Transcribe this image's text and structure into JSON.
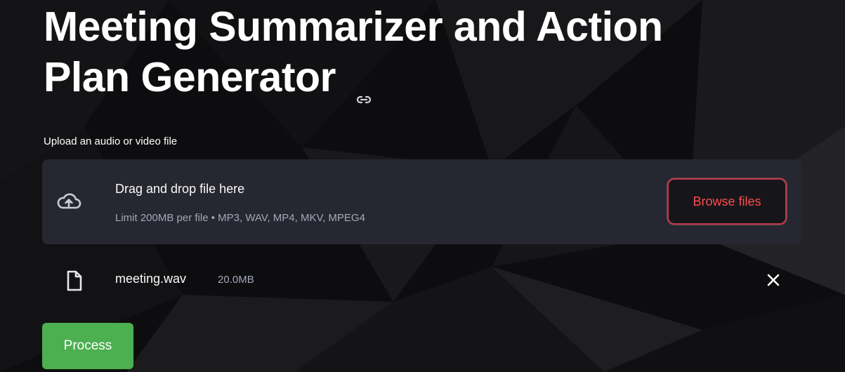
{
  "header": {
    "title_line1": "Meeting Summarizer and Action",
    "title_line2": "Plan Generator"
  },
  "uploader": {
    "label": "Upload an audio or video file",
    "dropzone_title": "Drag and drop file here",
    "dropzone_subtitle": "Limit 200MB per file • MP3, WAV, MP4, MKV, MPEG4",
    "browse_label": "Browse files"
  },
  "uploaded_file": {
    "name": "meeting.wav",
    "size": "20.0MB"
  },
  "actions": {
    "process_label": "Process"
  },
  "icons": {
    "link": "link-icon",
    "upload": "cloud-upload-icon",
    "file": "file-icon",
    "remove": "close-icon"
  },
  "colors": {
    "background": "#0e0e10",
    "dropzone": "#262730",
    "accent_red": "#ff4b4b",
    "process_green": "#4caf50",
    "muted_text": "#a3a8b8"
  }
}
